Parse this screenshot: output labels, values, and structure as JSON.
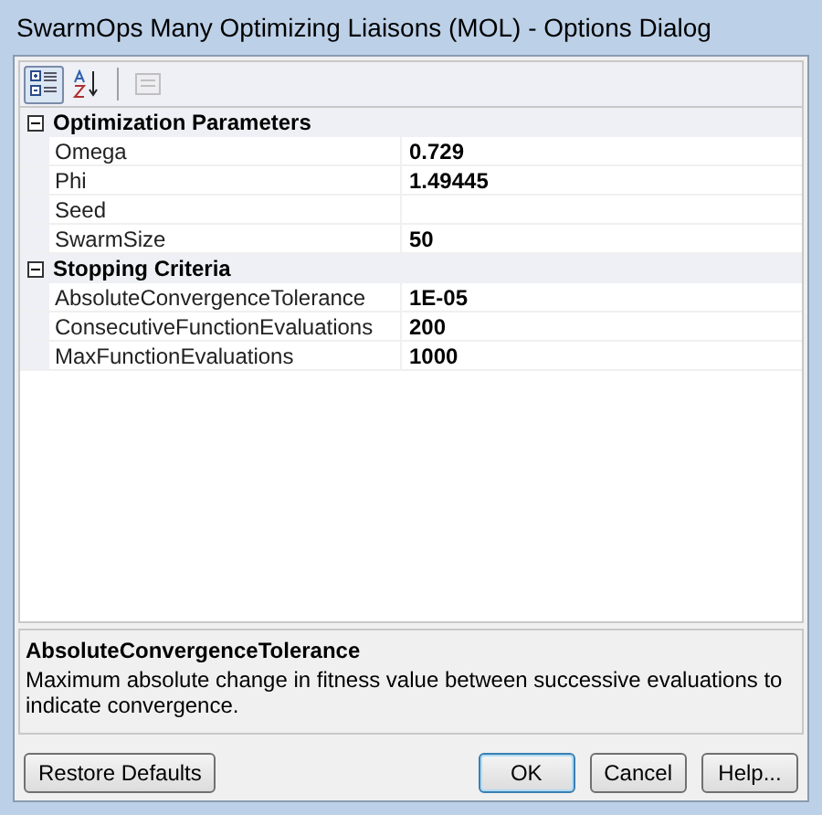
{
  "window": {
    "title": "SwarmOps Many Optimizing Liaisons (MOL) - Options Dialog"
  },
  "toolbar": [
    {
      "kind": "categorized",
      "selected": true,
      "disabled": false
    },
    {
      "kind": "alphabetical",
      "selected": false,
      "disabled": false
    },
    {
      "kind": "separator"
    },
    {
      "kind": "property-pages",
      "selected": false,
      "disabled": true
    }
  ],
  "categories": [
    {
      "name": "Optimization Parameters",
      "expanded": true,
      "properties": [
        {
          "name": "Omega",
          "value": "0.729"
        },
        {
          "name": "Phi",
          "value": "1.49445"
        },
        {
          "name": "Seed"
        },
        {
          "name": "SwarmSize",
          "value": "50"
        }
      ]
    },
    {
      "name": "Stopping Criteria",
      "expanded": true,
      "properties": [
        {
          "name": "AbsoluteConvergenceTolerance",
          "value": "1E-05"
        },
        {
          "name": "ConsecutiveFunctionEvaluations",
          "value": "200"
        },
        {
          "name": "MaxFunctionEvaluations",
          "value": "1000"
        }
      ]
    }
  ],
  "help": {
    "title": "AbsoluteConvergenceTolerance",
    "description": "Maximum absolute change in fitness value between successive evaluations to indicate convergence."
  },
  "buttons": [
    {
      "label": "Restore Defaults",
      "default": false
    },
    {
      "label": "OK",
      "default": true
    },
    {
      "label": "Cancel",
      "default": false
    },
    {
      "label": "Help...",
      "default": false
    }
  ]
}
